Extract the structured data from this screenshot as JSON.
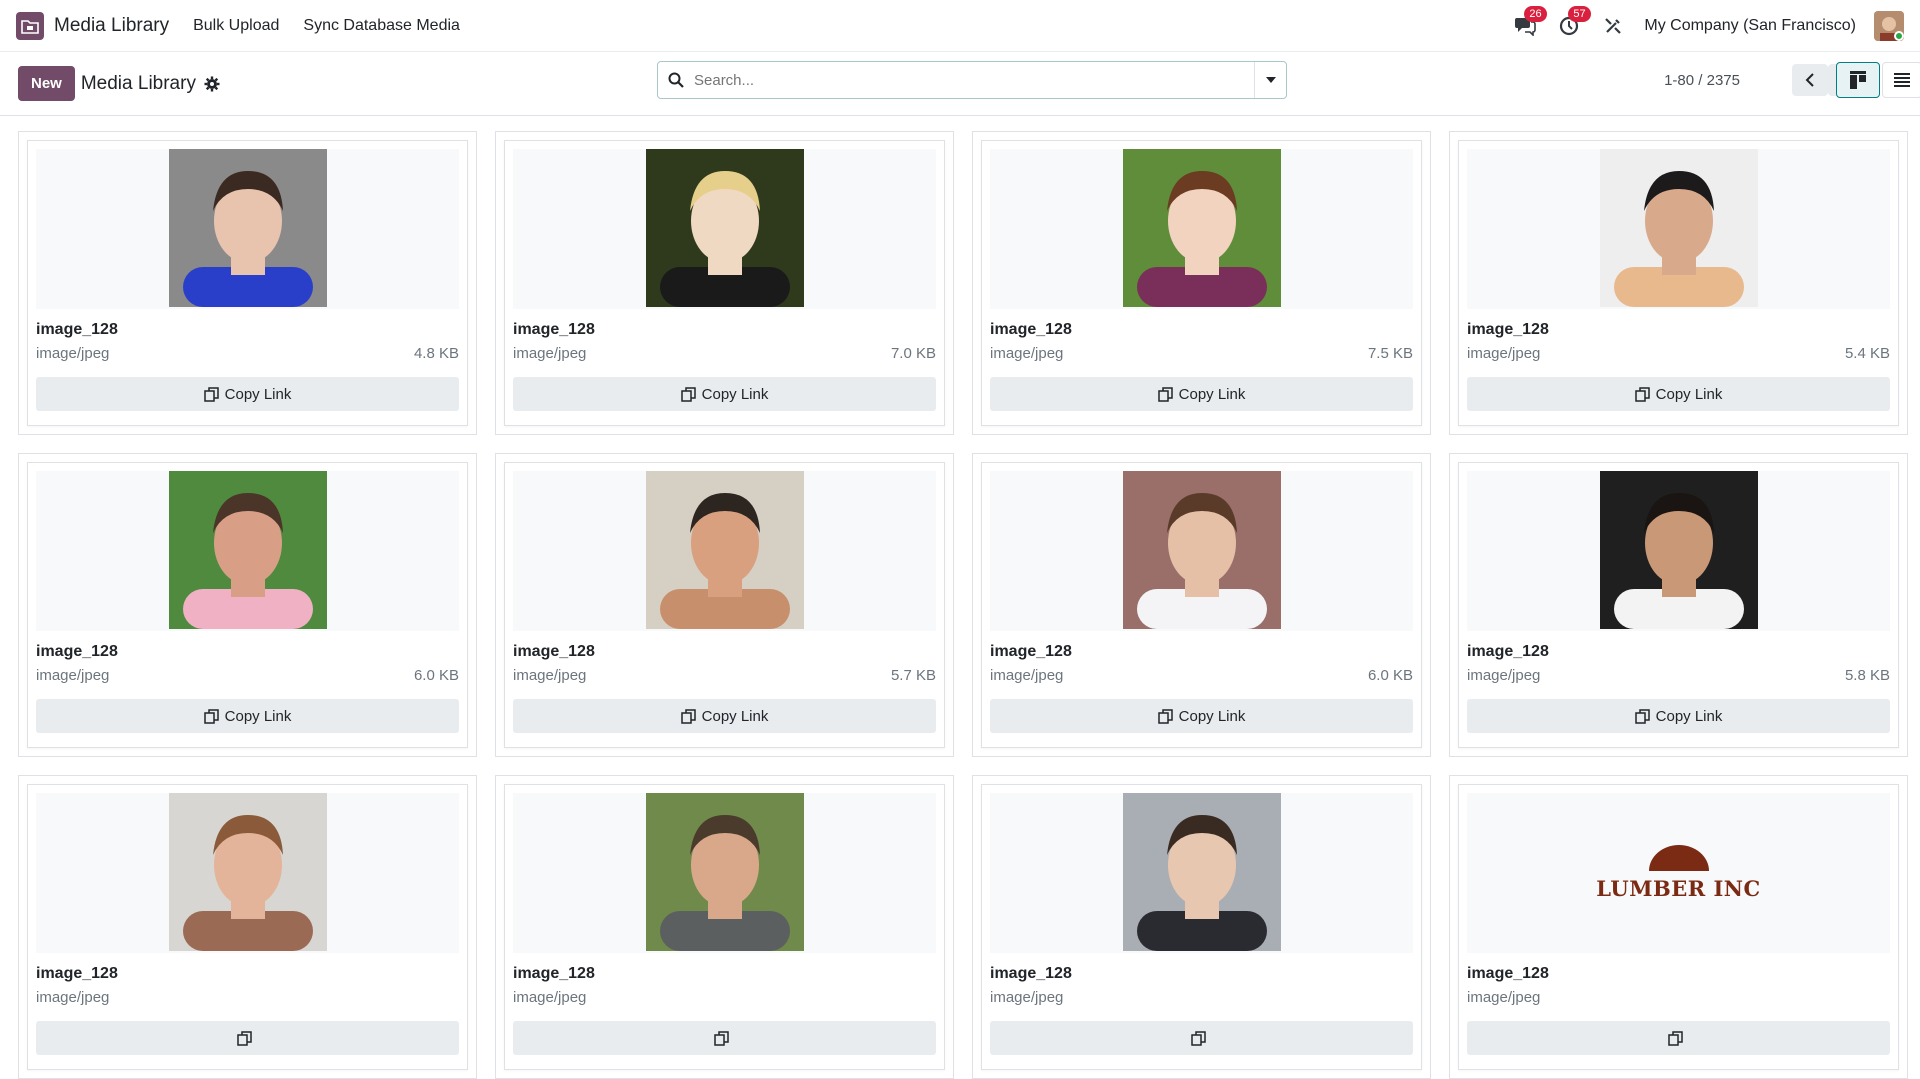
{
  "navbar": {
    "app_name": "Media Library",
    "links": [
      "Bulk Upload",
      "Sync Database Media"
    ],
    "messages_count": "26",
    "activities_count": "57",
    "company": "My Company (San Francisco)"
  },
  "control": {
    "new_label": "New",
    "title": "Media Library",
    "search_placeholder": "Search...",
    "pager": "1-80 / 2375"
  },
  "cards": [
    {
      "name": "image_128",
      "mimetype": "image/jpeg",
      "size": "4.8 KB",
      "copy_label": "Copy Link",
      "palette": [
        "#8a8a8a",
        "#2a3fc9",
        "#e8c4ae",
        "#3b2a22"
      ]
    },
    {
      "name": "image_128",
      "mimetype": "image/jpeg",
      "size": "7.0 KB",
      "copy_label": "Copy Link",
      "palette": [
        "#2f3a1c",
        "#1a1a1a",
        "#f0d9c3",
        "#e6cf8a"
      ]
    },
    {
      "name": "image_128",
      "mimetype": "image/jpeg",
      "size": "7.5 KB",
      "copy_label": "Copy Link",
      "palette": [
        "#5f8d3a",
        "#7a2f5a",
        "#f1d3bf",
        "#6b3b22"
      ]
    },
    {
      "name": "image_128",
      "mimetype": "image/jpeg",
      "size": "5.4 KB",
      "copy_label": "Copy Link",
      "palette": [
        "#eeeeee",
        "#e8b98c",
        "#d9a98b",
        "#1c1a1a"
      ]
    },
    {
      "name": "image_128",
      "mimetype": "image/jpeg",
      "size": "6.0 KB",
      "copy_label": "Copy Link",
      "palette": [
        "#4f8a3f",
        "#f0b1c4",
        "#d89f86",
        "#4a3528"
      ]
    },
    {
      "name": "image_128",
      "mimetype": "image/jpeg",
      "size": "5.7 KB",
      "copy_label": "Copy Link",
      "palette": [
        "#d6cfc4",
        "#c78f6c",
        "#d8a07e",
        "#2d2520"
      ]
    },
    {
      "name": "image_128",
      "mimetype": "image/jpeg",
      "size": "6.0 KB",
      "copy_label": "Copy Link",
      "palette": [
        "#9a6f6a",
        "#f4f4f7",
        "#e6c0a6",
        "#5a3a28"
      ]
    },
    {
      "name": "image_128",
      "mimetype": "image/jpeg",
      "size": "5.8 KB",
      "copy_label": "Copy Link",
      "palette": [
        "#1f1f1f",
        "#f3f3f3",
        "#c99877",
        "#1a1412"
      ]
    },
    {
      "name": "image_128",
      "mimetype": "image/jpeg",
      "size": "",
      "copy_label": "",
      "palette": [
        "#d8d6d2",
        "#9a6a55",
        "#e4b49a",
        "#8a5a3a"
      ]
    },
    {
      "name": "image_128",
      "mimetype": "image/jpeg",
      "size": "",
      "copy_label": "",
      "palette": [
        "#6f8a4a",
        "#5b5f60",
        "#d9a88a",
        "#4b3b2c"
      ]
    },
    {
      "name": "image_128",
      "mimetype": "image/jpeg",
      "size": "",
      "copy_label": "",
      "palette": [
        "#a9adb4",
        "#2a2b30",
        "#e8c7b1",
        "#3a2b22"
      ]
    },
    {
      "name": "image_128",
      "mimetype": "image/jpeg",
      "size": "",
      "copy_label": "",
      "logo_text": "LUMBER INC",
      "palette": [
        "#f8f9fa",
        "#7b2b13",
        "#7b2b13",
        "#7b2b13"
      ]
    }
  ],
  "colors": {
    "brand": "#714b67",
    "badge": "#d9213f"
  }
}
